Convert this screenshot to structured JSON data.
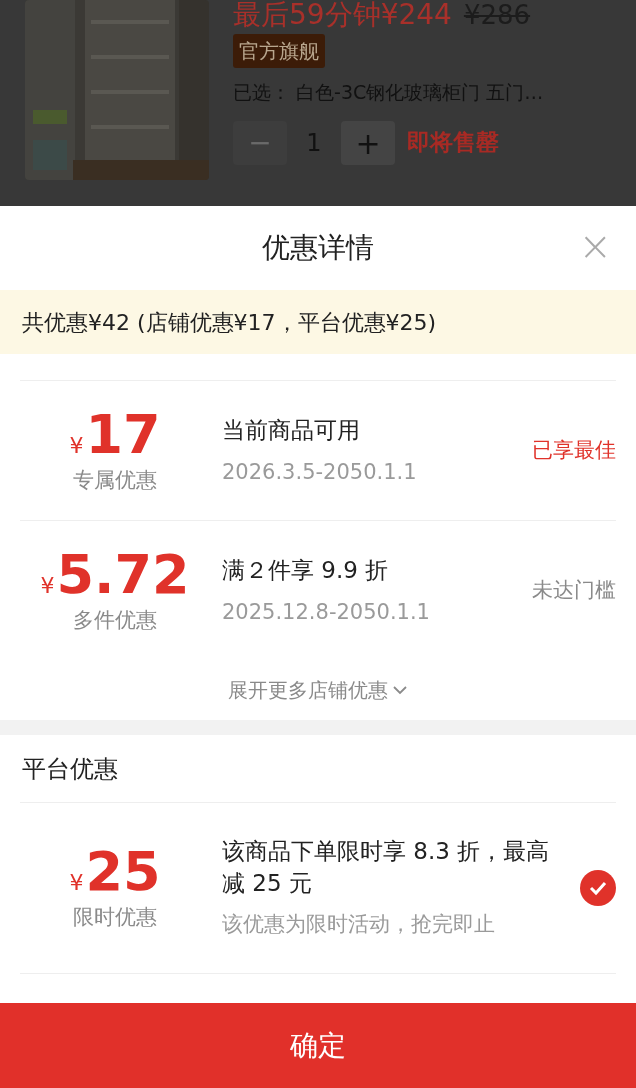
{
  "product": {
    "price": "最后59分钟¥244",
    "original_price": "¥286",
    "tag": "官方旗舰",
    "selected_spec": "已选：  白色-3C钢化玻璃柜门 五门…",
    "quantity": "1",
    "decrease": "−",
    "increase": "+",
    "stock_note": "即将售罄"
  },
  "sheet": {
    "title": "优惠详情",
    "close": "×",
    "summary": "共优惠¥42 (店铺优惠¥17，平台优惠¥25)"
  },
  "store_coupons": [
    {
      "currency": "¥",
      "amount": "17",
      "type": "专属优惠",
      "title": "当前商品可用",
      "validity": "2026.3.5-2050.1.1",
      "status": "已享最佳",
      "best": true
    },
    {
      "currency": "¥",
      "amount": "5.72",
      "type": "多件优惠",
      "title": "满２件享 9.9 折",
      "validity": "2025.12.8-2050.1.1",
      "status": "未达门槛",
      "best": false
    }
  ],
  "expand_link": "展开更多店铺优惠",
  "platform": {
    "heading": "平台优惠",
    "coupons": [
      {
        "currency": "¥",
        "amount": "25",
        "type": "限时优惠",
        "title": "该商品下单限时享 8.3 折，最高减 25 元",
        "note": "该优惠为限时活动，抢完即止",
        "checked": true
      }
    ]
  },
  "confirm": "确定"
}
